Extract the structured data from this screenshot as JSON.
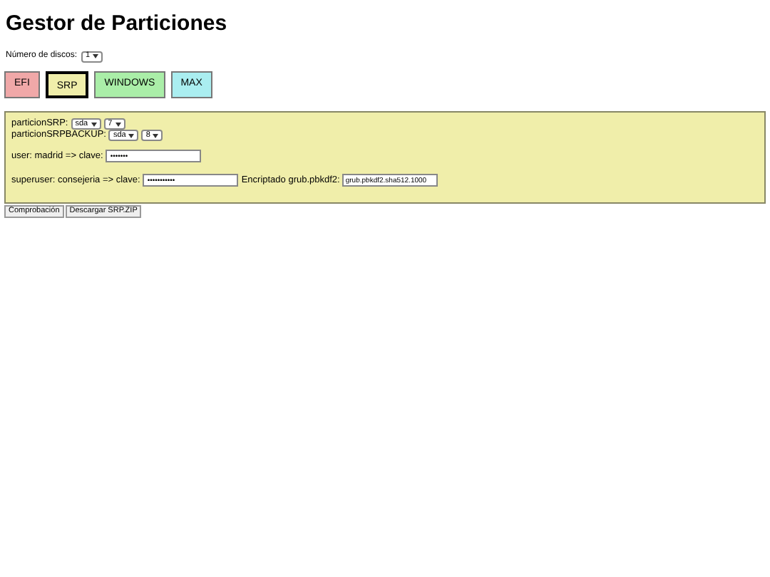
{
  "title": "Gestor de Particiones",
  "disks": {
    "label": "Número de discos:",
    "value": "1"
  },
  "tabs": [
    {
      "label": "EFI",
      "selected": false,
      "color": "#f0a8a8"
    },
    {
      "label": "SRP",
      "selected": true,
      "color": "#f0eeaa"
    },
    {
      "label": "WINDOWS",
      "selected": false,
      "color": "#aaeea8"
    },
    {
      "label": "MAX",
      "selected": false,
      "color": "#aaeef0"
    }
  ],
  "panel": {
    "partitions": [
      {
        "label": "particionSRP:",
        "disk": "sda",
        "number": "7"
      },
      {
        "label": "particionSRPBACKUP:",
        "disk": "sda",
        "number": "8"
      }
    ],
    "user": {
      "label": "user: madrid => clave:",
      "value": "•••••••"
    },
    "superuser": {
      "label": "superuser: consejeria => clave:",
      "value": "•••••••••••",
      "hash_label": "Encriptado grub.pbkdf2:",
      "hash_value": "grub.pbkdf2.sha512.1000"
    }
  },
  "buttons": [
    "Comprobación",
    "Descargar SRP.ZIP"
  ]
}
